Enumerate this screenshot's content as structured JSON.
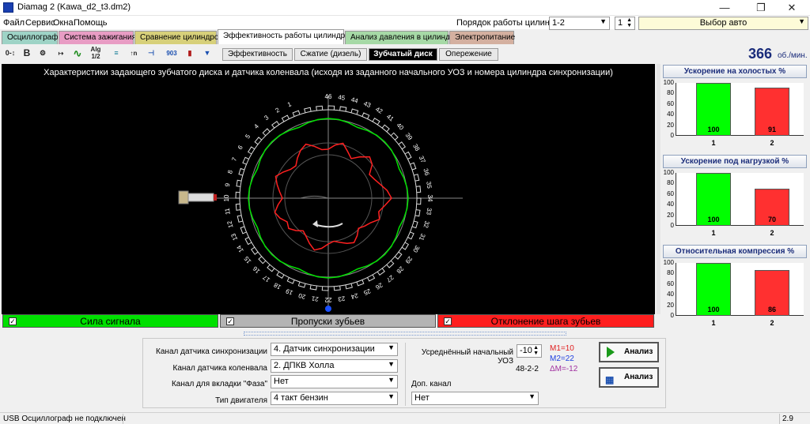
{
  "window": {
    "title": "Diamag 2 (Kawa_d2_t3.dm2)"
  },
  "menu": [
    "Файл",
    "Сервис",
    "Окна",
    "Помощь"
  ],
  "cylinder_order": {
    "label": "Порядок работы цилиндров",
    "value": "1-2",
    "number": "1",
    "auto_button": "Выбор авто"
  },
  "main_tabs": [
    "Осциллограф",
    "Система зажигания",
    "Сравнение цилиндров",
    "Эффективность работы цилиндров",
    "Анализ давления в цилиндре",
    "Электропитание"
  ],
  "main_tab_colors": [
    "#9ed3c6",
    "#e89cc4",
    "#d7d07a",
    "#ffffff",
    "#a6d9a6",
    "#d4b0a0"
  ],
  "sub_tabs": [
    "Эффективность",
    "Сжатие (дизель)",
    "Зубчатый диск",
    "Опережение"
  ],
  "rpm": {
    "value": "366",
    "unit": "об./мин."
  },
  "chart_title": "Характеристики задающего зубчатого диска и датчика коленвала (исходя из заданного начального УОЗ и номера цилиндра синхронизации)",
  "tooth_labels": [
    "46",
    "45",
    "44",
    "43",
    "42",
    "41",
    "40",
    "39",
    "38",
    "37",
    "36",
    "35",
    "34",
    "33",
    "32",
    "31",
    "30",
    "29",
    "28",
    "27",
    "26",
    "25",
    "24",
    "23",
    "22",
    "21",
    "20",
    "19",
    "18",
    "17",
    "16",
    "15",
    "14",
    "13",
    "12",
    "11",
    "10",
    "9",
    "8",
    "7",
    "6",
    "5",
    "4",
    "3",
    "2",
    "1"
  ],
  "checkbars": [
    {
      "label": "Сила сигнала",
      "color": "#00e000"
    },
    {
      "label": "Пропуски зубьев",
      "color": "#b4b4b4"
    },
    {
      "label": "Отклонение шага зубьев",
      "color": "#ff1e1e"
    }
  ],
  "panels": [
    {
      "title": "Ускорение на холостых %",
      "bars": [
        {
          "cyl": "1",
          "value": 100,
          "color": "#00ff00"
        },
        {
          "cyl": "2",
          "value": 91,
          "color": "#ff3030"
        }
      ]
    },
    {
      "title": "Ускорение под нагрузкой %",
      "bars": [
        {
          "cyl": "1",
          "value": 100,
          "color": "#00ff00"
        },
        {
          "cyl": "2",
          "value": 70,
          "color": "#ff3030"
        }
      ]
    },
    {
      "title": "Относительная компрессия %",
      "bars": [
        {
          "cyl": "1",
          "value": 100,
          "color": "#00ff00"
        },
        {
          "cyl": "2",
          "value": 86,
          "color": "#ff3030"
        }
      ]
    }
  ],
  "y_ticks": [
    "100",
    "80",
    "60",
    "40",
    "20",
    "0"
  ],
  "form": {
    "sync_channel": {
      "label": "Канал датчика синхронизации",
      "value": "4.  Датчик синхронизации"
    },
    "crank_channel": {
      "label": "Канал датчика коленвала",
      "value": "2.  ДПКВ Холла"
    },
    "phase_channel": {
      "label": "Канал для вкладки \"Фаза\"",
      "value": "Нет"
    },
    "engine_type": {
      "label": "Тип двигателя",
      "value": "4 такт бензин"
    },
    "uoz": {
      "label": "Усреднённый начальный УОЗ",
      "value": "-10"
    },
    "wheel": "48-2-2",
    "extra_channel": {
      "label": "Доп. канал",
      "value": "Нет"
    },
    "m1": "M1=10",
    "m2": "M2=22",
    "dm": "ΔM=-12",
    "analyze1": "Анализ",
    "analyze2": "Анализ"
  },
  "status": {
    "left": "USB Осциллограф не подключен",
    "right": "2.9"
  }
}
